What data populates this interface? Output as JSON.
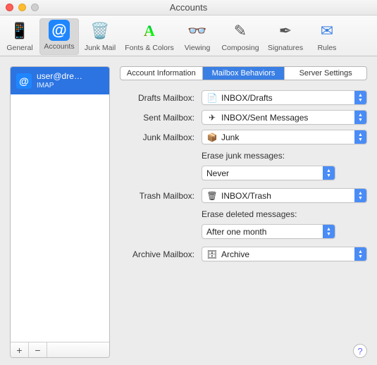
{
  "window": {
    "title": "Accounts"
  },
  "toolbar": [
    {
      "label": "General",
      "icon": "📱",
      "selected": false
    },
    {
      "label": "Accounts",
      "icon": "@",
      "selected": true
    },
    {
      "label": "Junk Mail",
      "icon": "🗑️",
      "selected": false
    },
    {
      "label": "Fonts & Colors",
      "icon": "A",
      "selected": false
    },
    {
      "label": "Viewing",
      "icon": "👓",
      "selected": false
    },
    {
      "label": "Composing",
      "icon": "✎",
      "selected": false
    },
    {
      "label": "Signatures",
      "icon": "✒︎",
      "selected": false
    },
    {
      "label": "Rules",
      "icon": "✉︎",
      "selected": false
    }
  ],
  "sidebar": {
    "accounts": [
      {
        "name": "user@dre…",
        "sub": "IMAP",
        "selected": true
      }
    ],
    "add": "+",
    "remove": "−"
  },
  "tabs": [
    {
      "label": "Account Information",
      "selected": false
    },
    {
      "label": "Mailbox Behaviors",
      "selected": true
    },
    {
      "label": "Server Settings",
      "selected": false
    }
  ],
  "form": {
    "drafts": {
      "label": "Drafts Mailbox:",
      "value": "INBOX/Drafts",
      "icon": "📄"
    },
    "sent": {
      "label": "Sent Mailbox:",
      "value": "INBOX/Sent Messages",
      "icon": "✈︎"
    },
    "junk": {
      "label": "Junk Mailbox:",
      "value": "Junk",
      "icon": "📦"
    },
    "eraseJunkLabel": "Erase junk messages:",
    "eraseJunk": {
      "value": "Never"
    },
    "trash": {
      "label": "Trash Mailbox:",
      "value": "INBOX/Trash",
      "icon": "🗑"
    },
    "eraseDeletedLabel": "Erase deleted messages:",
    "eraseDeleted": {
      "value": "After one month"
    },
    "archive": {
      "label": "Archive Mailbox:",
      "value": "Archive",
      "icon": "🗄"
    }
  },
  "help": "?"
}
